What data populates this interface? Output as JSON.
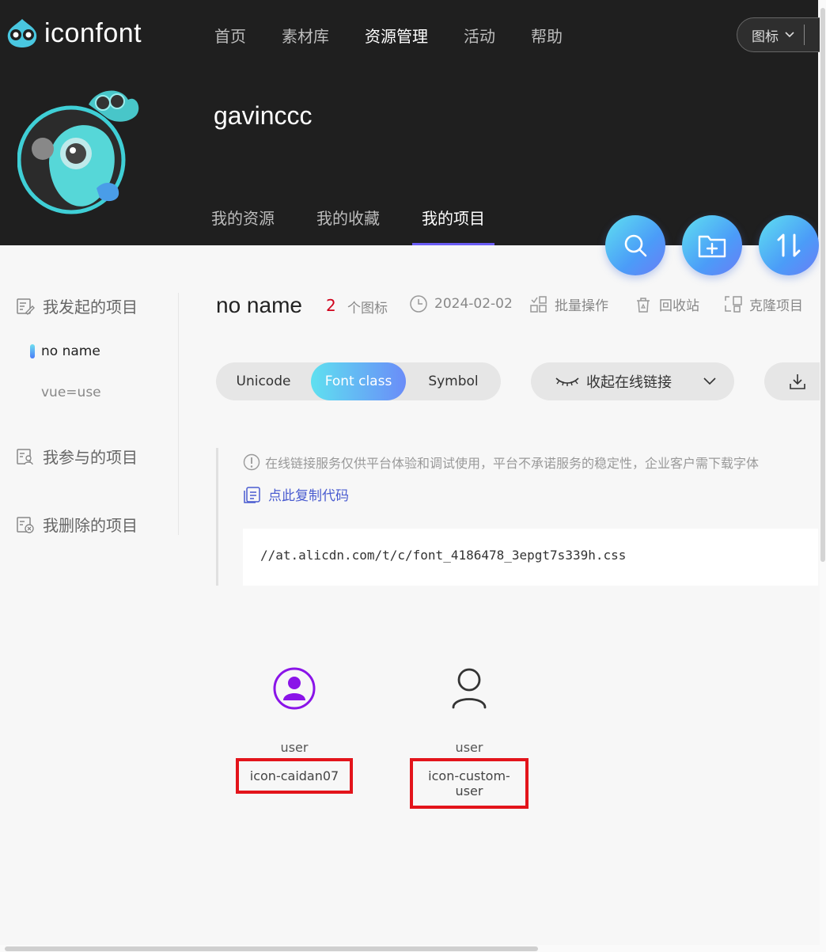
{
  "app": {
    "logo_text": "iconfont"
  },
  "topnav": {
    "items": [
      {
        "label": "首页",
        "active": false
      },
      {
        "label": "素材库",
        "active": false
      },
      {
        "label": "资源管理",
        "active": true
      },
      {
        "label": "活动",
        "active": false
      },
      {
        "label": "帮助",
        "active": false
      }
    ],
    "search_type": "图标"
  },
  "profile": {
    "username": "gavinccc"
  },
  "subnav": {
    "items": [
      {
        "label": "我的资源",
        "active": false
      },
      {
        "label": "我的收藏",
        "active": false
      },
      {
        "label": "我的项目",
        "active": true
      }
    ]
  },
  "fabs": [
    "search-icon",
    "new-folder-icon",
    "sort-icon"
  ],
  "sidebar": {
    "groups": [
      {
        "label": "我发起的项目",
        "icon": "project-edit-icon"
      },
      {
        "label": "我参与的项目",
        "icon": "project-user-icon"
      },
      {
        "label": "我删除的项目",
        "icon": "project-delete-icon"
      }
    ],
    "projects": [
      {
        "label": "no name",
        "active": true
      },
      {
        "label": "vue=use",
        "active": false
      }
    ]
  },
  "project": {
    "title": "no name",
    "icon_count": "2",
    "icon_count_label": "个图标",
    "date": "2024-02-02",
    "actions": {
      "batch": "批量操作",
      "recycle": "回收站",
      "clone": "克隆项目"
    }
  },
  "tabs": {
    "items": [
      {
        "label": "Unicode",
        "active": false
      },
      {
        "label": "Font class",
        "active": true
      },
      {
        "label": "Symbol",
        "active": false
      }
    ],
    "link_toggle": "收起在线链接"
  },
  "notice": {
    "text": "在线链接服务仅供平台体验和调试使用，平台不承诺服务的稳定性，企业客户需下载字体",
    "copy_label": "点此复制代码",
    "code": "//at.alicdn.com/t/c/font_4186478_3epgt7s339h.css"
  },
  "icons": [
    {
      "name": "user",
      "code": "icon-caidan07",
      "color": "#8a14e8",
      "glyph": "user-circle-icon"
    },
    {
      "name": "user",
      "code": "icon-custom-user",
      "color": "#333333",
      "glyph": "user-outline-icon"
    }
  ],
  "colors": {
    "header_bg": "#1f1f1f",
    "accent_purple": "#6a5cf5",
    "count_red": "#d0021b",
    "highlight_red": "#e3141b",
    "link_blue": "#4a5cd0"
  }
}
